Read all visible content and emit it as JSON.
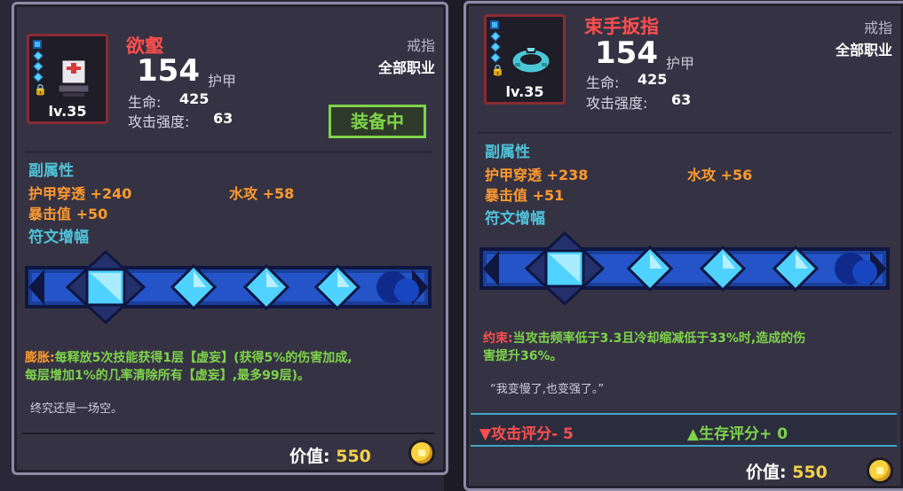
{
  "left": {
    "name": "欲壑",
    "armor_value": "154",
    "armor_label": "护甲",
    "type": "戒指",
    "class": "全部职业",
    "level": "lv.35",
    "hp_label": "生命:",
    "hp_value": "425",
    "atk_label": "攻击强度:",
    "atk_value": "63",
    "equipped": "装备中",
    "sub_header": "副属性",
    "sub_stats": [
      "护甲穿透 +240",
      "水攻 +58",
      "暴击值 +50"
    ],
    "rune_header": "符文增幅",
    "effect_name": "膨胀:",
    "effect_text": "每释放5次技能获得1层【虚妄】(获得5%的伤害加成,",
    "effect_text2": "每层增加1%的几率清除所有【虚妄】,最多99层)。",
    "flavor": "终究还是一场空。",
    "price_label": "价值:",
    "price": "550"
  },
  "right": {
    "name": "束手扳指",
    "armor_value": "154",
    "armor_label": "护甲",
    "type": "戒指",
    "class": "全部职业",
    "level": "lv.35",
    "hp_label": "生命:",
    "hp_value": "425",
    "atk_label": "攻击强度:",
    "atk_value": "63",
    "sub_header": "副属性",
    "sub_stats": [
      "护甲穿透 +238",
      "水攻 +56",
      "暴击值 +51"
    ],
    "rune_header": "符文增幅",
    "effect_name": "约束:",
    "effect_text": "当攻击频率低于3.3且冷却缩减低于33%时,造成的伤",
    "effect_text2": "害提升36%。",
    "flavor": "“我变慢了,也变强了。”",
    "rating_attack": "▼攻击评分- 5",
    "rating_survival": "▲生存评分+ 0",
    "price_label": "价值:",
    "price": "550"
  },
  "colors": {
    "name_red": "#ff4e4e",
    "substat_orange": "#ff9a2e",
    "header_cyan": "#4fc3d9",
    "effect_green": "#7ed34a",
    "price_gold": "#f3d24a"
  },
  "icons": [
    "helmet-icon",
    "ring-icon",
    "gem-icon",
    "lock-icon",
    "coin-icon",
    "rune-gem-icon"
  ]
}
